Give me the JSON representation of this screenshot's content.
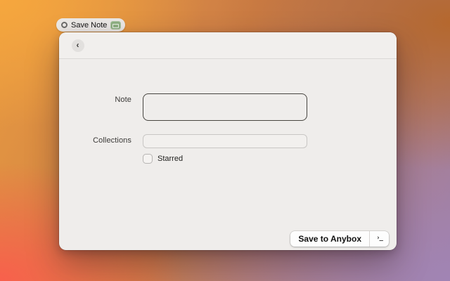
{
  "colors": {
    "wallpaper_orange": "#f6a73e",
    "wallpaper_coral": "#f8604c",
    "wallpaper_brown": "#b5682e",
    "wallpaper_purple": "#a184b4",
    "window_bg": "#efedeb",
    "app_icon_green": "#8fb183"
  },
  "menubar_item": {
    "label": "Save Note",
    "left_icon": "gear-icon",
    "right_icon": "anybox-app-icon"
  },
  "window": {
    "header": {
      "back_icon": "‹"
    },
    "form": {
      "note": {
        "label": "Note",
        "value": "",
        "placeholder": ""
      },
      "collections": {
        "label": "Collections",
        "value": "",
        "placeholder": ""
      },
      "starred": {
        "label": "Starred",
        "checked": false
      }
    },
    "footer": {
      "save_button_label": "Save to Anybox",
      "run_icon": "›_"
    }
  }
}
